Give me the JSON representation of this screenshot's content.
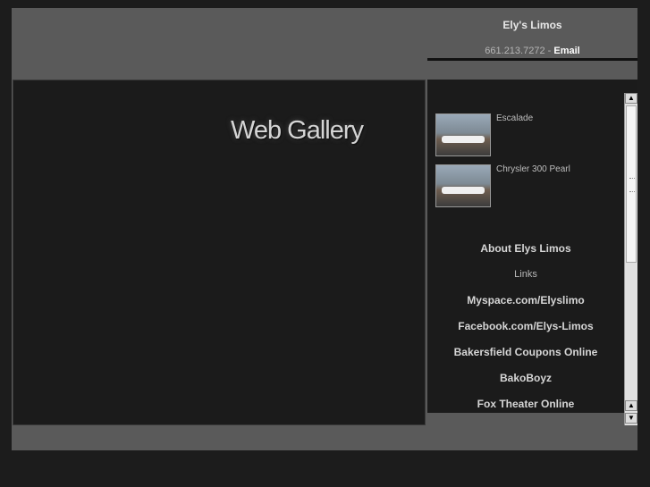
{
  "header": {
    "site_title": "Ely's Limos",
    "phone": "661.213.7272",
    "separator": " - ",
    "email_label": "Email"
  },
  "main": {
    "gallery_title": "Web Gallery"
  },
  "gallery": {
    "items": [
      {
        "label": "Escalade"
      },
      {
        "label": "Chrysler 300 Pearl"
      }
    ]
  },
  "sidebar": {
    "links": [
      {
        "label": "About Elys Limos"
      },
      {
        "label": "Links"
      },
      {
        "label": "Myspace.com/Elyslimo"
      },
      {
        "label": "Facebook.com/Elys-Limos"
      },
      {
        "label": "Bakersfield Coupons Online"
      },
      {
        "label": "BakoBoyz"
      },
      {
        "label": "Fox Theater Online"
      }
    ]
  },
  "colors": {
    "frame": "#5a5a5a",
    "panel": "#1b1b1b",
    "page_bg": "#1c1c1c"
  }
}
